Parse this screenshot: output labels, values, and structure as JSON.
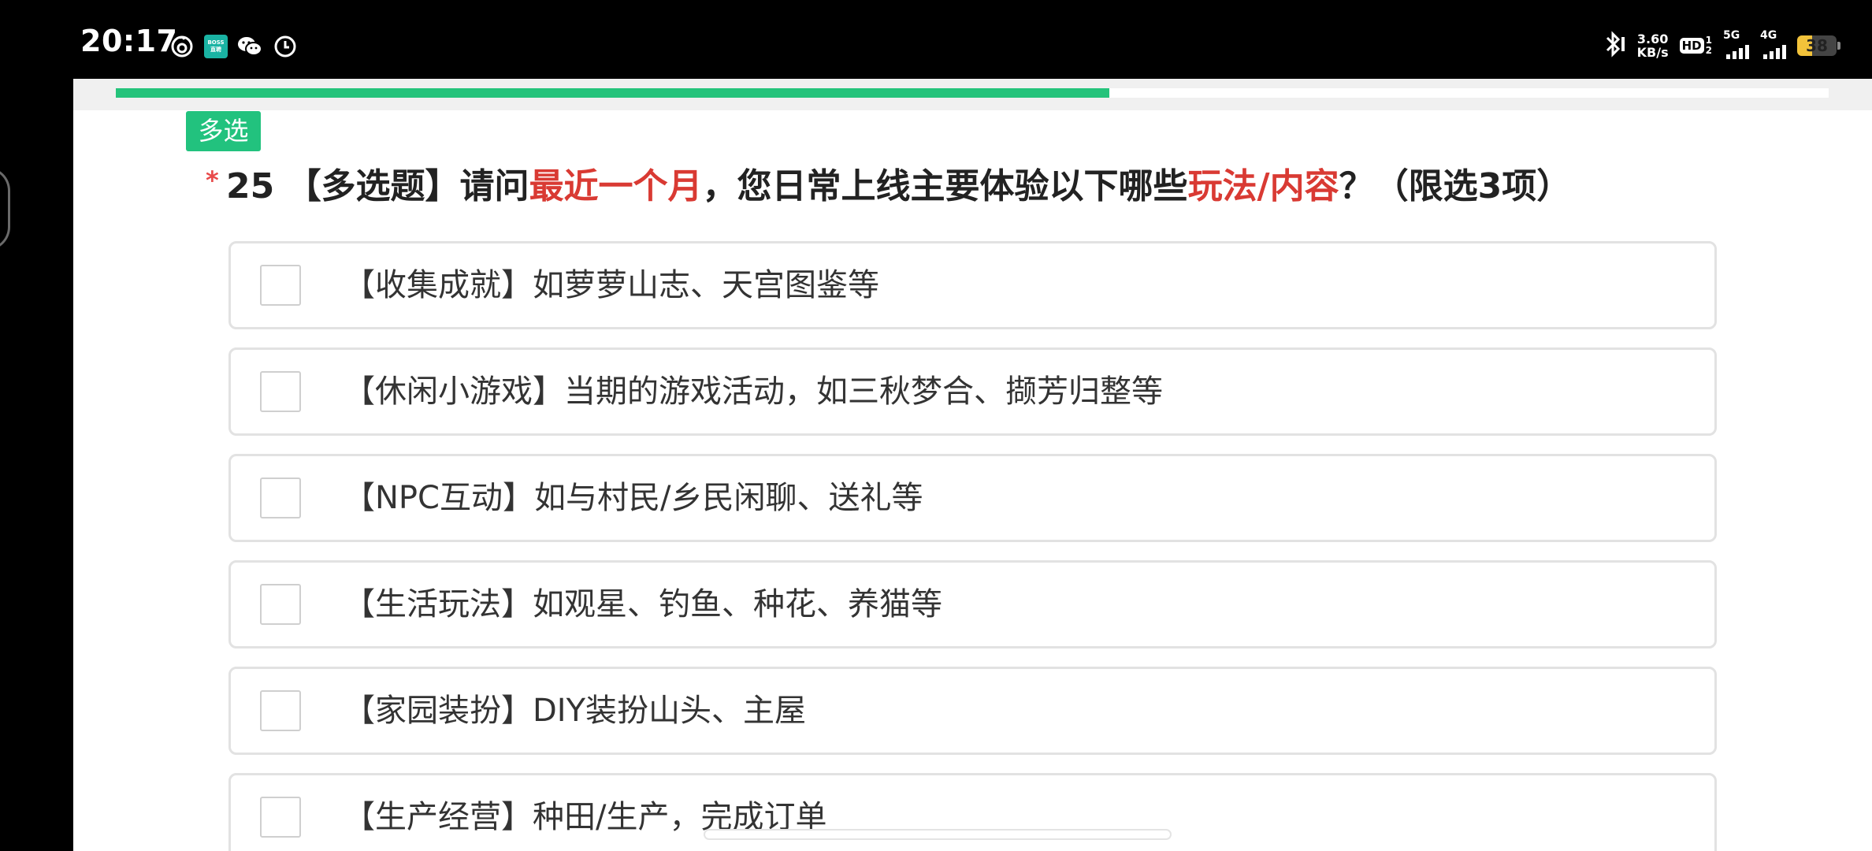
{
  "status_bar": {
    "time": "20:17",
    "net_speed_value": "3.60",
    "net_speed_unit": "KB/s",
    "hd_label": "HD",
    "hd_sub_top": "1",
    "hd_sub_bottom": "2",
    "signal_1_label": "5G",
    "signal_2_label": "4G",
    "battery_level": "38",
    "battery_percent": 38,
    "boss_app_text_top": "BOSS",
    "boss_app_text_bottom": "直聘",
    "icons": [
      "netease-music-icon",
      "boss-app-icon",
      "wechat-icon",
      "clock-app-icon",
      "bluetooth-icon"
    ]
  },
  "survey": {
    "progress_percent": 58,
    "question_type_badge": "多选",
    "required_mark": "*",
    "question": {
      "number": "25",
      "prefix": "【多选题】请问",
      "highlight_1": "最近一个月",
      "middle": "，您日常上线主要体验以下哪些",
      "highlight_2": "玩法/内容",
      "suffix": "？（限选3项）"
    },
    "options": [
      {
        "label": "【收集成就】如萝萝山志、天宫图鉴等",
        "checked": false
      },
      {
        "label": "【休闲小游戏】当期的游戏活动，如三秋梦合、撷芳归整等",
        "checked": false
      },
      {
        "label": "【NPC互动】如与村民/乡民闲聊、送礼等",
        "checked": false
      },
      {
        "label": "【生活玩法】如观星、钓鱼、种花、养猫等",
        "checked": false
      },
      {
        "label": "【家园装扮】DIY装扮山头、主屋",
        "checked": false
      },
      {
        "label": "【生产经营】种田/生产，完成订单",
        "checked": false
      }
    ],
    "colors": {
      "accent_green": "#22c27e",
      "highlight_red": "#d93a33",
      "required_red": "#e84a4a"
    }
  }
}
